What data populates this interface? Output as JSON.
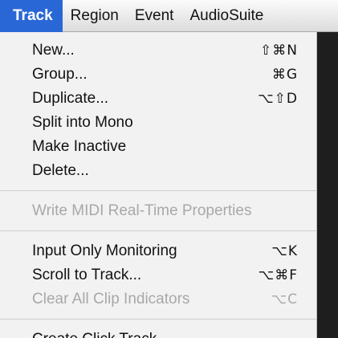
{
  "menubar": {
    "items": [
      "Track",
      "Region",
      "Event",
      "AudioSuite"
    ]
  },
  "track_menu": {
    "group1": [
      {
        "label": "New...",
        "shortcut": "⇧⌘N",
        "enabled": true
      },
      {
        "label": "Group...",
        "shortcut": "⌘G",
        "enabled": true
      },
      {
        "label": "Duplicate...",
        "shortcut": "⌥⇧D",
        "enabled": true
      },
      {
        "label": "Split into Mono",
        "shortcut": "",
        "enabled": true
      },
      {
        "label": "Make Inactive",
        "shortcut": "",
        "enabled": true
      },
      {
        "label": "Delete...",
        "shortcut": "",
        "enabled": true
      }
    ],
    "group2": [
      {
        "label": "Write MIDI Real-Time Properties",
        "shortcut": "",
        "enabled": false
      }
    ],
    "group3": [
      {
        "label": "Input Only Monitoring",
        "shortcut": "⌥K",
        "enabled": true
      },
      {
        "label": "Scroll to Track...",
        "shortcut": "⌥⌘F",
        "enabled": true
      },
      {
        "label": "Clear All Clip Indicators",
        "shortcut": "⌥C",
        "enabled": false
      }
    ],
    "group4": [
      {
        "label": "Create Click Track",
        "shortcut": "",
        "enabled": true
      }
    ]
  }
}
